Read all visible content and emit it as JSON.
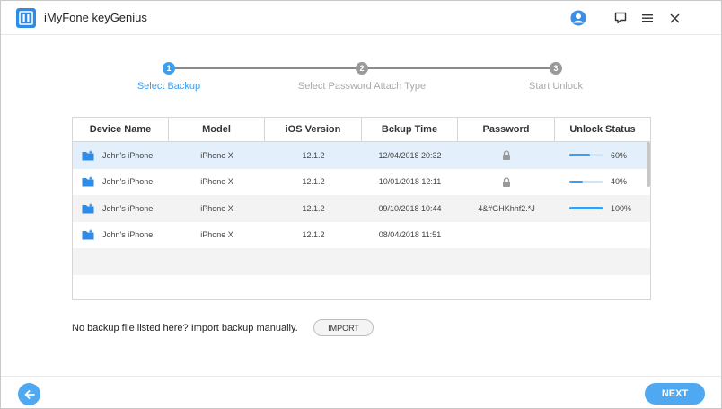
{
  "app": {
    "title": "iMyFone keyGenius",
    "logo_icon": "keygenius-logo-icon"
  },
  "titlebar": {
    "icons": [
      "user-icon",
      "feedback-icon",
      "menu-icon",
      "close-icon"
    ]
  },
  "steps": [
    {
      "number": "1",
      "label": "Select Backup",
      "active": true
    },
    {
      "number": "2",
      "label": "Select Password Attach Type",
      "active": false
    },
    {
      "number": "3",
      "label": "Start Unlock",
      "active": false
    }
  ],
  "table": {
    "headers": [
      "Device Name",
      "Model",
      "iOS Version",
      "Bckup Time",
      "Password",
      "Unlock Status"
    ],
    "rows": [
      {
        "device": "John's iPhone",
        "model": "iPhone X",
        "ios": "12.1.2",
        "time": "12/04/2018 20:32",
        "password": "",
        "password_locked": true,
        "progress": 0.6,
        "status": "60%"
      },
      {
        "device": "John's iPhone",
        "model": "iPhone X",
        "ios": "12.1.2",
        "time": "10/01/2018 12:11",
        "password": "",
        "password_locked": true,
        "progress": 0.4,
        "status": "40%"
      },
      {
        "device": "John's iPhone",
        "model": "iPhone X",
        "ios": "12.1.2",
        "time": "09/10/2018 10:44",
        "password": "4&#GHKhhf2.*J",
        "password_locked": false,
        "progress": 1.0,
        "status": "100%"
      },
      {
        "device": "John's iPhone",
        "model": "iPhone X",
        "ios": "12.1.2",
        "time": "08/04/2018 11:51",
        "password": "",
        "password_locked": false,
        "progress": null,
        "status": ""
      }
    ]
  },
  "import": {
    "text": "No backup file listed here? Import backup manually.",
    "button_label": "IMPORT"
  },
  "footer": {
    "next_label": "NEXT",
    "back_icon": "arrow-left-icon"
  },
  "colors": {
    "accent": "#3b9ff0",
    "button": "#4ea9f2",
    "selected_row": "#e3f0fc",
    "alt_row": "#f3f3f3"
  }
}
